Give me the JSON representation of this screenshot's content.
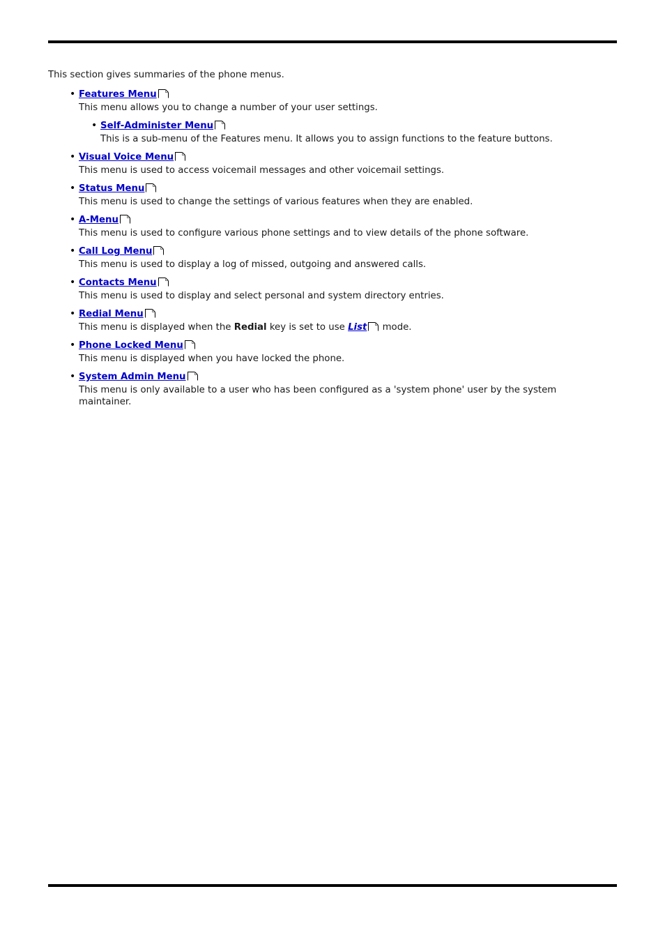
{
  "document": {
    "intro": "This section gives summaries of the phone menus.",
    "icon_name": "page-link-icon",
    "link_color": "#0000c8",
    "rule_color": "#000000"
  },
  "menus": [
    {
      "title": "Features Menu",
      "description": "This menu allows you to change a number of your user settings.",
      "children": [
        {
          "title": "Self-Administer Menu",
          "description": "This is a sub-menu of the Features menu. It allows you to assign functions to the feature buttons."
        }
      ]
    },
    {
      "title": "Visual Voice Menu",
      "description": "This menu is used to access voicemail messages and other voicemail settings."
    },
    {
      "title": "Status Menu",
      "description": "This menu is used to change the settings of various features when they are enabled."
    },
    {
      "title": "A-Menu",
      "description": "This menu is used to configure various phone settings and to view details of the phone software."
    },
    {
      "title": "Call Log Menu",
      "description": "This menu is used to display a log of missed, outgoing and answered calls."
    },
    {
      "title": "Contacts Menu",
      "description": "This menu is used to display and select personal and system directory entries."
    },
    {
      "title": "Redial Menu",
      "description_parts": {
        "before_bold": "This menu is displayed when the ",
        "bold": "Redial",
        "after_bold": " key is set to use ",
        "inline_link": "List",
        "after_link": " mode."
      }
    },
    {
      "title": "Phone Locked Menu",
      "description": "This menu is displayed when you have locked the phone."
    },
    {
      "title": "System Admin Menu",
      "description": "This menu is only available to a user who has been configured as a 'system phone' user by the system maintainer."
    }
  ]
}
